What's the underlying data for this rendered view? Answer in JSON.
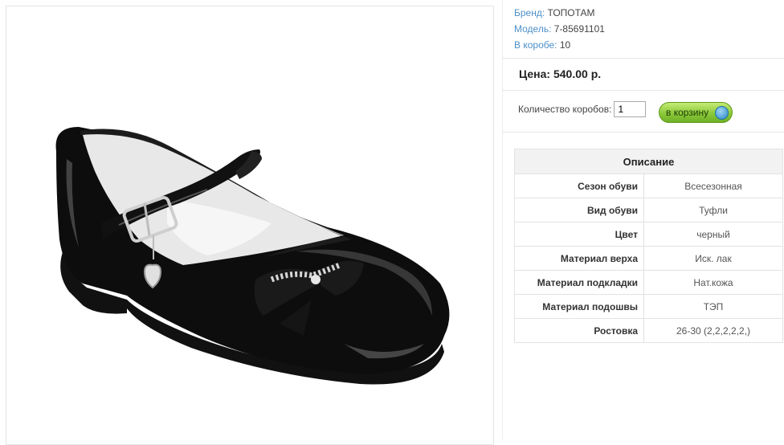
{
  "product": {
    "image_alt": "shoe-image",
    "brand_label": "Бренд:",
    "brand_value": "ТОПОТАМ",
    "model_label": "Модель:",
    "model_value": "7-85691101",
    "box_label": "В коробе:",
    "box_value": "10",
    "price_text": "Цена: 540.00 р.",
    "qty_label": "Количество коробов:",
    "qty_value": "1",
    "cart_button": "в корзину"
  },
  "specs": {
    "title": "Описание",
    "rows": [
      {
        "key": "Сезон обуви",
        "value": "Всесезонная"
      },
      {
        "key": "Вид обуви",
        "value": "Туфли"
      },
      {
        "key": "Цвет",
        "value": "черный"
      },
      {
        "key": "Материал верха",
        "value": "Иск. лак"
      },
      {
        "key": "Материал подкладки",
        "value": "Нат.кожа"
      },
      {
        "key": "Материал подошвы",
        "value": "ТЭП"
      },
      {
        "key": "Ростовка",
        "value": "26-30 (2,2,2,2,2,)"
      }
    ]
  },
  "colors": {
    "label_blue": "#4d8fc9",
    "cart_green": "#8bc93a"
  }
}
